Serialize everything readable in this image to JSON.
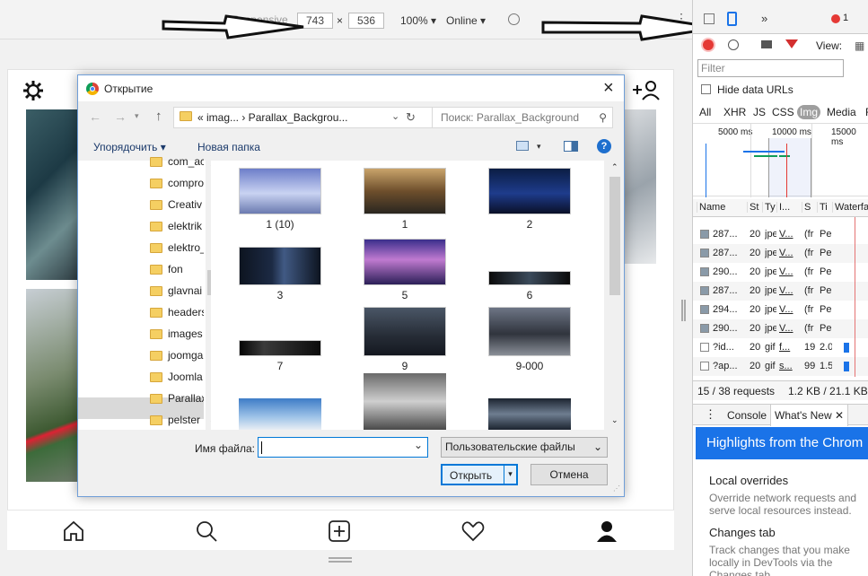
{
  "devbar": {
    "mode": "Responsive",
    "width": "743",
    "times": "×",
    "height": "536",
    "zoom": "100%",
    "throttle": "Online"
  },
  "dialog": {
    "title": "Открытие",
    "breadcrumb": "« imag... › Parallax_Backgrou...",
    "search_placeholder": "Поиск: Parallax_Background",
    "organize": "Упорядочить ▾",
    "new_folder": "Новая папка",
    "tree": [
      "com_ac",
      "compro",
      "Creativ",
      "elektrik",
      "elektro_",
      "fon",
      "glavnai",
      "headers",
      "images",
      "joomga",
      "Joomla",
      "Parallax",
      "pelster"
    ],
    "files": [
      "1 (10)",
      "1",
      "2",
      "3",
      "5",
      "6",
      "7",
      "9",
      "9-000"
    ],
    "filename_label": "Имя файла:",
    "filename_value": "",
    "filetype": "Пользовательские файлы",
    "open": "Открыть",
    "cancel": "Отмена"
  },
  "devtools": {
    "filter_placeholder": "Filter",
    "hide_data_urls": "Hide data URLs",
    "types": [
      "All",
      "XHR",
      "JS",
      "CSS",
      "Img",
      "Media",
      "F"
    ],
    "timeline": [
      "5000 ms",
      "10000 ms",
      "15000 ms"
    ],
    "view": "View:",
    "columns": [
      "Name",
      "St",
      "Ty",
      "I...",
      "S",
      "Ti",
      "Waterfa"
    ],
    "rows": [
      {
        "name": "287...",
        "st": "20",
        "ty": "jpe",
        "in": "V...",
        "s": "(fr",
        "ti": "Pe"
      },
      {
        "name": "287...",
        "st": "20",
        "ty": "jpe",
        "in": "V...",
        "s": "(fr",
        "ti": "Pe"
      },
      {
        "name": "290...",
        "st": "20",
        "ty": "jpe",
        "in": "V...",
        "s": "(fr",
        "ti": "Pe"
      },
      {
        "name": "287...",
        "st": "20",
        "ty": "jpe",
        "in": "V...",
        "s": "(fr",
        "ti": "Pe"
      },
      {
        "name": "294...",
        "st": "20",
        "ty": "jpe",
        "in": "V...",
        "s": "(fr",
        "ti": "Pe"
      },
      {
        "name": "290...",
        "st": "20",
        "ty": "jpe",
        "in": "V...",
        "s": "(fr",
        "ti": "Pe"
      },
      {
        "name": "?id...",
        "st": "20",
        "ty": "gif",
        "in": "f...",
        "s": "19",
        "ti": "2.0"
      },
      {
        "name": "?ap...",
        "st": "20",
        "ty": "gif",
        "in": "s...",
        "s": "99",
        "ti": "1.5"
      }
    ],
    "summary": "15 / 38 requests",
    "transferred": "1.2 KB / 21.1 KB t",
    "drawer_tabs": [
      "Console",
      "What's New"
    ],
    "error_count": "1",
    "banner": "Highlights from the Chrom",
    "items": [
      {
        "title": "Local overrides",
        "desc": "Override network requests and serve local resources instead."
      },
      {
        "title": "Changes tab",
        "desc": "Track changes that you make locally in DevTools via the Changes tab."
      }
    ]
  }
}
